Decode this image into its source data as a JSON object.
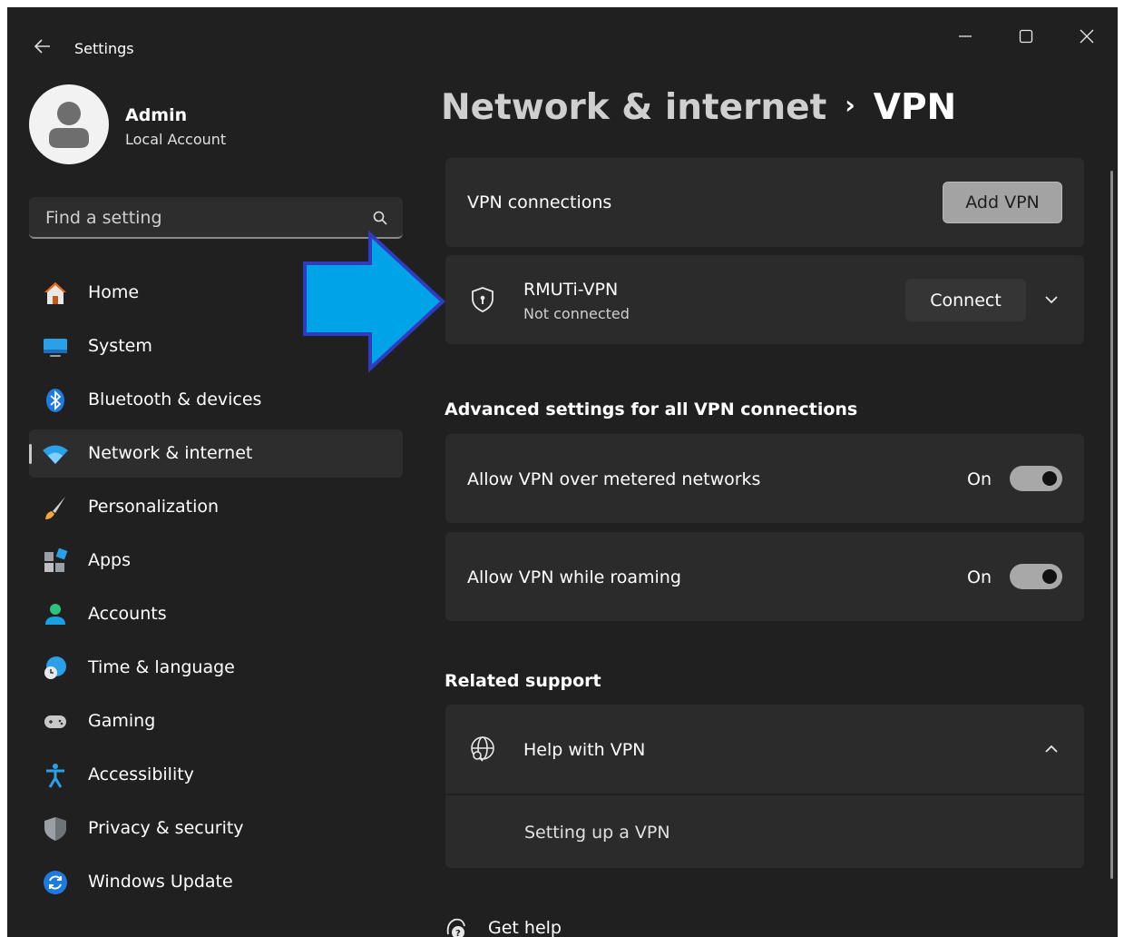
{
  "window": {
    "title": "Settings"
  },
  "profile": {
    "name": "Admin",
    "account_type": "Local Account"
  },
  "search": {
    "placeholder": "Find a setting"
  },
  "sidebar": {
    "items": [
      {
        "label": "Home",
        "icon": "home-icon"
      },
      {
        "label": "System",
        "icon": "system-icon"
      },
      {
        "label": "Bluetooth & devices",
        "icon": "bluetooth-icon"
      },
      {
        "label": "Network & internet",
        "icon": "wifi-icon",
        "active": true
      },
      {
        "label": "Personalization",
        "icon": "brush-icon"
      },
      {
        "label": "Apps",
        "icon": "apps-icon"
      },
      {
        "label": "Accounts",
        "icon": "accounts-icon"
      },
      {
        "label": "Time & language",
        "icon": "globe-clock-icon"
      },
      {
        "label": "Gaming",
        "icon": "gamepad-icon"
      },
      {
        "label": "Accessibility",
        "icon": "accessibility-icon"
      },
      {
        "label": "Privacy & security",
        "icon": "shield-icon"
      },
      {
        "label": "Windows Update",
        "icon": "update-icon"
      }
    ]
  },
  "breadcrumb": {
    "parent": "Network & internet",
    "separator": "›",
    "current": "VPN"
  },
  "vpn": {
    "connections_label": "VPN connections",
    "add_button": "Add VPN",
    "connection": {
      "name": "RMUTi-VPN",
      "status": "Not connected",
      "connect_button": "Connect"
    }
  },
  "advanced": {
    "title": "Advanced settings for all VPN connections",
    "metered": {
      "label": "Allow VPN over metered networks",
      "state": "On",
      "enabled": true
    },
    "roaming": {
      "label": "Allow VPN while roaming",
      "state": "On",
      "enabled": true
    }
  },
  "support": {
    "title": "Related support",
    "help_label": "Help with VPN",
    "link": "Setting up a VPN",
    "get_help": "Get help"
  },
  "colors": {
    "background": "#202020",
    "card": "#2b2b2b",
    "overlay_arrow": "#00a2e8",
    "overlay_arrow_border": "#2f3cbf"
  }
}
